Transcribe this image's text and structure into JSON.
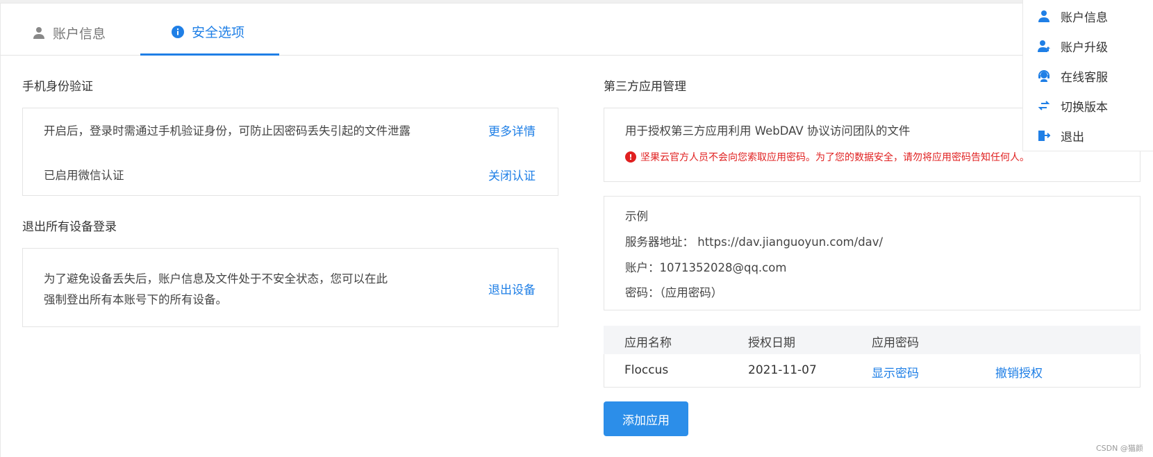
{
  "tabs": [
    {
      "label": "账户信息",
      "icon": "user-icon"
    },
    {
      "label": "安全选项",
      "icon": "info-icon"
    }
  ],
  "phone_verify": {
    "title": "手机身份验证",
    "desc": "开启后，登录时需通过手机验证身份，可防止因密码丢失引起的文件泄露",
    "more_link": "更多详情",
    "status": "已启用微信认证",
    "disable_link": "关闭认证"
  },
  "logout_all": {
    "title": "退出所有设备登录",
    "desc_line1": "为了避免设备丢失后，账户信息及文件处于不安全状态，您可以在此",
    "desc_line2": "强制登出所有本账号下的所有设备。",
    "link": "退出设备"
  },
  "third_party": {
    "title": "第三方应用管理",
    "desc": "用于授权第三方应用利用 WebDAV 协议访问团队的文件",
    "warning": "坚果云官方人员不会向您索取应用密码。为了您的数据安全，请勿将应用密码告知任何人。",
    "example": {
      "title": "示例",
      "server_label": "服务器地址：",
      "server_value": "https://dav.jianguoyun.com/dav/",
      "account_label": "账户：",
      "account_value": "1071352028@qq.com",
      "password_label": "密码：",
      "password_value": "（应用密码）"
    },
    "table": {
      "headers": [
        "应用名称",
        "授权日期",
        "应用密码"
      ],
      "rows": [
        {
          "name": "Floccus",
          "date": "2021-11-07",
          "show": "显示密码",
          "revoke": "撤销授权"
        }
      ]
    },
    "add_button": "添加应用"
  },
  "dropdown_menu": [
    {
      "label": "账户信息",
      "icon": "user-icon"
    },
    {
      "label": "账户升级",
      "icon": "user-upgrade-icon"
    },
    {
      "label": "在线客服",
      "icon": "headset-icon"
    },
    {
      "label": "切换版本",
      "icon": "switch-arrows-icon"
    },
    {
      "label": "退出",
      "icon": "logout-icon"
    }
  ],
  "colors": {
    "accent": "#1f7fe6",
    "button": "#2c8ee9",
    "warning": "#e02020"
  },
  "credit": "CSDN @猫颜"
}
